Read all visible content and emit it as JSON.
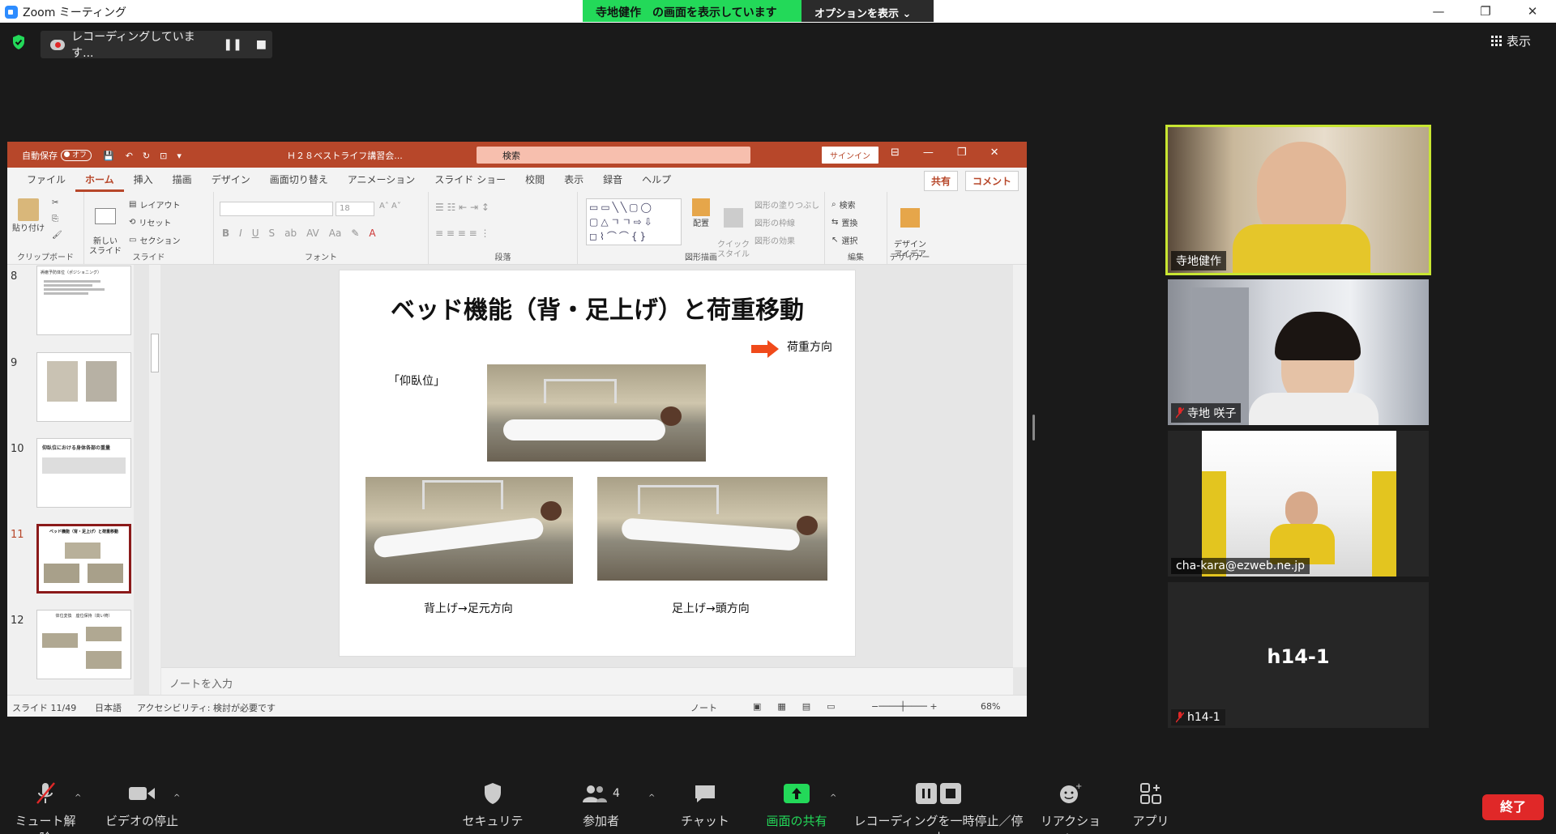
{
  "window": {
    "title": "Zoom ミーティング",
    "minimize": "—",
    "restore": "❐",
    "close": "✕"
  },
  "share_banner": {
    "viewing": "寺地健作　の画面を表示しています",
    "options": "オプションを表示 ⌄"
  },
  "recording": {
    "status": "レコーディングしています...",
    "pause": "❚❚",
    "stop": "■"
  },
  "view_button": "表示",
  "ppt": {
    "autosave_label": "自動保存",
    "autosave_toggle": "オフ",
    "doc_title": "Ｈ２８ベストライフ講習会...",
    "search_placeholder": "検索",
    "signin": "サインイン",
    "tabs": [
      "ファイル",
      "ホーム",
      "挿入",
      "描画",
      "デザイン",
      "画面切り替え",
      "アニメーション",
      "スライド ショー",
      "校閲",
      "表示",
      "録音",
      "ヘルプ"
    ],
    "share": "共有",
    "comment": "コメント",
    "ribbon": {
      "paste": "貼り付け",
      "clipboard": "クリップボード",
      "new_slide": "新しい\nスライド",
      "layout": "レイアウト",
      "reset": "リセット",
      "section": "セクション",
      "slide_group": "スライド",
      "font_size": "18",
      "font_group": "フォント",
      "paragraph_group": "段落",
      "arrange": "配置",
      "quick_style": "クイック\nスタイル",
      "shape_fill": "図形の塗りつぶし",
      "shape_outline": "図形の枠線",
      "shape_effect": "図形の効果",
      "drawing_group": "図形描画",
      "find": "検索",
      "replace": "置換",
      "select": "選択",
      "editing_group": "編集",
      "design_ideas": "デザイン\nアイデア",
      "designer_group": "デザイナー"
    },
    "thumbnails": [
      {
        "num": "8",
        "title": "褥瘡予防体位（ポジショニング）"
      },
      {
        "num": "9",
        "title": ""
      },
      {
        "num": "10",
        "title": "仰臥位における身体各部の重量"
      },
      {
        "num": "11",
        "title": "ベッド機能（背・足上げ）と荷重移動"
      },
      {
        "num": "12",
        "title": "体位変換　座位保持（高い椅）"
      }
    ],
    "slide": {
      "title": "ベッド機能（背・足上げ）と荷重移動",
      "load_direction": "荷重方向",
      "supine": "「仰臥位」",
      "caption_left": "背上げ→足元方向",
      "caption_right": "足上げ→頭方向"
    },
    "notes_placeholder": "ノートを入力",
    "status": {
      "slide_count": "スライド 11/49",
      "language": "日本語",
      "accessibility": "アクセシビリティ: 検討が必要です",
      "notes": "ノート",
      "zoom": "68%"
    }
  },
  "participants": [
    {
      "name": "寺地健作",
      "muted": false
    },
    {
      "name": "寺地 咲子",
      "muted": true
    },
    {
      "name": "cha-kara@ezweb.ne.jp",
      "muted": false
    },
    {
      "name": "h14-1",
      "muted": true,
      "big_label": "h14-1"
    }
  ],
  "toolbar": {
    "unmute": "ミュート解除",
    "stop_video": "ビデオの停止",
    "security": "セキュリティ",
    "participants": "参加者",
    "participant_count": "4",
    "chat": "チャット",
    "share_screen": "画面の共有",
    "pause_recording": "レコーディングを一時停止／停止",
    "reactions": "リアクション",
    "apps": "アプリ",
    "end": "終了"
  },
  "colors": {
    "zoom_green": "#23d959",
    "ppt_accent": "#b7472a",
    "end_red": "#e02828",
    "active_speaker": "#c8e632"
  }
}
